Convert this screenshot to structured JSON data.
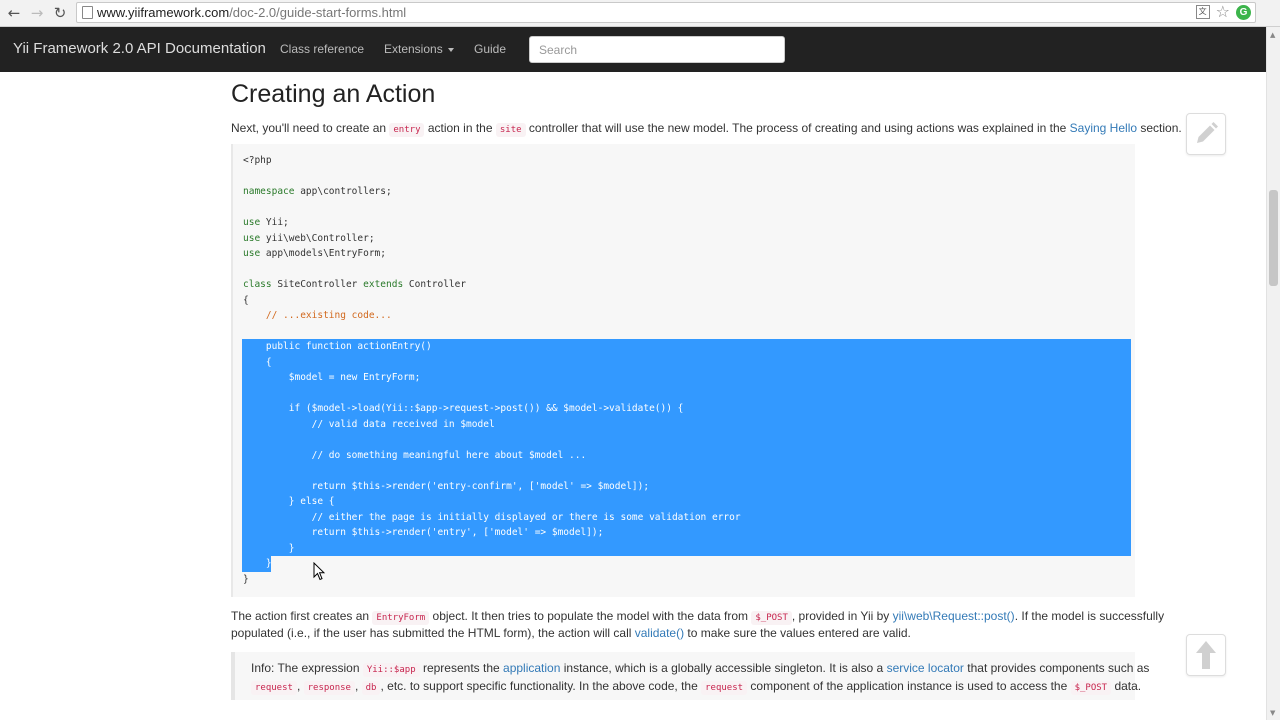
{
  "browser": {
    "url_host": "www.yiiframework.com",
    "url_path": "/doc-2.0/guide-start-forms.html",
    "icons": [
      "back-arrow-icon",
      "forward-arrow-icon",
      "reload-icon",
      "page-icon",
      "translate-icon",
      "star-icon",
      "extension-icon"
    ]
  },
  "navbar": {
    "brand": "Yii Framework 2.0 API Documentation",
    "links": [
      "Class reference",
      "Extensions",
      "Guide"
    ],
    "search_placeholder": "Search"
  },
  "content": {
    "heading": "Creating an Action",
    "intro": {
      "p1": "Next, you'll need to create an ",
      "c1": "entry",
      "p2": " action in the ",
      "c2": "site",
      "p3": " controller that will use the new model. The process of creating and using actions was explained in the ",
      "link": "Saying Hello",
      "p4": " section."
    },
    "code_lines": [
      "<?php",
      "",
      "namespace app\\controllers;",
      "",
      "use Yii;",
      "use yii\\web\\Controller;",
      "use app\\models\\EntryForm;",
      "",
      "class SiteController extends Controller",
      "{",
      "    // ...existing code...",
      "",
      "    public function actionEntry()",
      "    {",
      "        $model = new EntryForm;",
      "",
      "        if ($model->load(Yii::$app->request->post()) && $model->validate()) {",
      "            // valid data received in $model",
      "",
      "            // do something meaningful here about $model ...",
      "",
      "            return $this->render('entry-confirm', ['model' => $model]);",
      "        } else {",
      "            // either the page is initially displayed or there is some validation error",
      "            return $this->render('entry', ['model' => $model]);",
      "        }",
      "    }",
      "}"
    ],
    "explain": {
      "l1a": "The action first creates an ",
      "l1c1": "EntryForm",
      "l1b": " object. It then tries to populate the model with the data from ",
      "l1c2": "$_POST",
      "l1d": ", provided in Yii by ",
      "l1link": "yii\\web\\Request::post()",
      "l1e": ". If the model is successfully",
      "l2a": "populated (i.e., if the user has submitted the HTML form), the action will call ",
      "l2link": "validate()",
      "l2b": " to make sure the values entered are valid."
    },
    "info": {
      "a": "Info: The expression ",
      "c1": "Yii::$app",
      "b": " represents the ",
      "link1": "application",
      "c": " instance, which is a globally accessible singleton. It is also a ",
      "link2": "service locator",
      "d": " that provides components such as",
      "c2": "request",
      "e": ", ",
      "c3": "response",
      "f": ", ",
      "c4": "db",
      "g": ", etc. to support specific functionality. In the above code, the ",
      "c5": "request",
      "h": " component of the application instance is used to access the ",
      "c6": "$_POST",
      "i": " data."
    }
  },
  "floating": {
    "edit_icon": "pencil-icon",
    "top_icon": "arrow-up-icon"
  },
  "colors": {
    "navbar": "#222222",
    "selection": "#3399ff",
    "link": "#337ab7",
    "code_keyword": "#2a7a2a",
    "code_comment": "#d2691e"
  }
}
